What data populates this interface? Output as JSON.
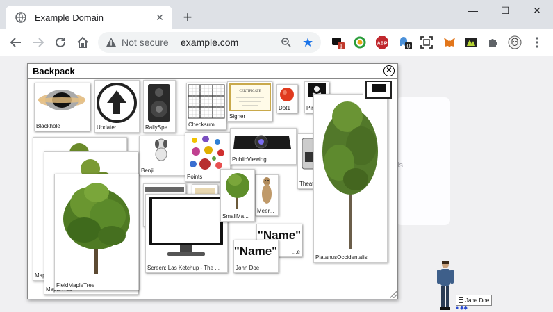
{
  "browser": {
    "tab_title": "Example Domain",
    "new_tab": "+",
    "security": "Not secure",
    "url": "example.com",
    "window_controls": {
      "minimize": "—",
      "maximize": "☐",
      "close": "✕"
    }
  },
  "extensions": [
    {
      "name": "ext-badge-icon",
      "badge": "1"
    },
    {
      "name": "ext-circle-icon"
    },
    {
      "name": "adblock-plus-icon",
      "label": "ABP"
    },
    {
      "name": "ghost-icon",
      "badge": "0"
    },
    {
      "name": "screenshot-icon"
    },
    {
      "name": "metamask-icon"
    },
    {
      "name": "ext-green-icon"
    },
    {
      "name": "puzzle-icon"
    },
    {
      "name": "profile-icon"
    }
  ],
  "page": {
    "fragment": "is"
  },
  "backpack": {
    "title": "Backpack",
    "items": [
      {
        "id": "blackhole",
        "label": "Blackhole"
      },
      {
        "id": "updater",
        "label": "Updater"
      },
      {
        "id": "rallyspeaker",
        "label": "RallySpe..."
      },
      {
        "id": "checksum",
        "label": "Checksum..."
      },
      {
        "id": "signer",
        "label": "Signer",
        "cert_title": "CERTIFICATE"
      },
      {
        "id": "dot1",
        "label": "Dot1"
      },
      {
        "id": "pirate",
        "label": "Pira..."
      },
      {
        "id": "benji",
        "label": "Benji"
      },
      {
        "id": "points",
        "label": "Points"
      },
      {
        "id": "publicviewing",
        "label": "PublicViewing"
      },
      {
        "id": "theater",
        "label": "Theat..."
      },
      {
        "id": "maple1",
        "label": "Map..."
      },
      {
        "id": "maple2",
        "label": "MapleTree"
      },
      {
        "id": "fieldmaple",
        "label": "FieldMapleTree"
      },
      {
        "id": "m",
        "label": "M"
      },
      {
        "id": "screen",
        "label": "Screen: Las Ketchup - The ..."
      },
      {
        "id": "smallmaple",
        "label": "SmallMa..."
      },
      {
        "id": "meerkat",
        "label": "Meer..."
      },
      {
        "id": "name2",
        "label": "...e",
        "text": "\"Name\""
      },
      {
        "id": "johndoe",
        "label": "John Doe",
        "text": "\"Name\""
      },
      {
        "id": "platanus",
        "label": "PlatanusOccidentalis"
      }
    ]
  },
  "avatar": {
    "name": "Jane Doe"
  }
}
